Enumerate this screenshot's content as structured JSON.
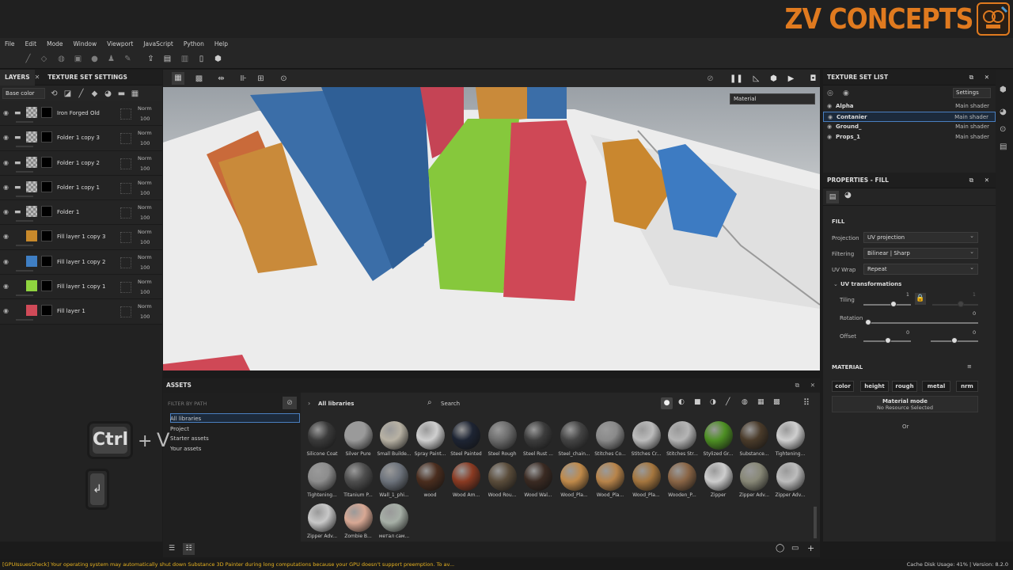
{
  "brand": {
    "text": "ZV CONCEPTS"
  },
  "menu": [
    "File",
    "Edit",
    "Mode",
    "Window",
    "Viewport",
    "JavaScript",
    "Python",
    "Help"
  ],
  "left_panel": {
    "tabs": [
      "LAYERS",
      "TEXTURE SET SETTINGS"
    ],
    "channel": "Base color",
    "layers": [
      {
        "name": "Iron Forged Old",
        "blend": "Norm",
        "opacity": "100",
        "type": "folder"
      },
      {
        "name": "Folder 1 copy 3",
        "blend": "Norm",
        "opacity": "100",
        "type": "folder"
      },
      {
        "name": "Folder 1 copy 2",
        "blend": "Norm",
        "opacity": "100",
        "type": "folder"
      },
      {
        "name": "Folder 1 copy 1",
        "blend": "Norm",
        "opacity": "100",
        "type": "folder"
      },
      {
        "name": "Folder 1",
        "blend": "Norm",
        "opacity": "100",
        "type": "folder"
      },
      {
        "name": "Fill layer 1 copy 3",
        "blend": "Norm",
        "opacity": "100",
        "type": "fill",
        "color": "#c8892b"
      },
      {
        "name": "Fill layer 1 copy 2",
        "blend": "Norm",
        "opacity": "100",
        "type": "fill",
        "color": "#3f7fc4"
      },
      {
        "name": "Fill layer 1 copy 1",
        "blend": "Norm",
        "opacity": "100",
        "type": "fill",
        "color": "#8fd43f"
      },
      {
        "name": "Fill layer 1",
        "blend": "Norm",
        "opacity": "100",
        "type": "fill",
        "color": "#d04a58"
      }
    ]
  },
  "viewport": {
    "material_mode": "Material"
  },
  "texture_set_list": {
    "title": "TEXTURE SET LIST",
    "settings": "Settings",
    "sets": [
      {
        "name": "Alpha",
        "shader": "Main shader"
      },
      {
        "name": "Contanier",
        "shader": "Main shader"
      },
      {
        "name": "Ground_",
        "shader": "Main shader"
      },
      {
        "name": "Props_1",
        "shader": "Main shader"
      }
    ]
  },
  "properties": {
    "title": "PROPERTIES - FILL",
    "fill_heading": "FILL",
    "projection_label": "Projection",
    "projection": "UV projection",
    "filtering_label": "Filtering",
    "filtering": "Bilinear | Sharp",
    "uvwrap_label": "UV Wrap",
    "uvwrap": "Repeat",
    "uv_transform": "UV transformations",
    "tiling_label": "Tiling",
    "tiling_value": "1",
    "tiling_value2": "1",
    "rotation_label": "Rotation",
    "rotation_value": "0",
    "offset_label": "Offset",
    "offset_x": "0",
    "offset_y": "0",
    "material_heading": "MATERIAL",
    "channels": [
      "color",
      "height",
      "rough",
      "metal",
      "nrm"
    ],
    "material_mode_label": "Material mode",
    "material_mode_value": "No Resource Selected",
    "or": "Or"
  },
  "assets": {
    "title": "ASSETS",
    "filter_placeholder": "FILTER BY PATH",
    "libraries": [
      "All libraries",
      "Project",
      "Starter assets",
      "Your assets"
    ],
    "breadcrumb": "All libraries",
    "search": "Search",
    "materials": [
      {
        "name": "Silicone Coat",
        "color": "#3a3a3a"
      },
      {
        "name": "Silver Pure",
        "color": "#9a9a9a"
      },
      {
        "name": "Small Builde...",
        "color": "#b8b2a4"
      },
      {
        "name": "Spray Paint...",
        "color": "#cfcfcf"
      },
      {
        "name": "Steel Painted",
        "color": "#1d2433"
      },
      {
        "name": "Steel Rough",
        "color": "#6c6c6c"
      },
      {
        "name": "Steel Rust ...",
        "color": "#3c3c3c"
      },
      {
        "name": "Steel_chain...",
        "color": "#444444"
      },
      {
        "name": "Stitches Co...",
        "color": "#8a8a8a"
      },
      {
        "name": "Stitches Cr...",
        "color": "#bcbcbc"
      },
      {
        "name": "Stitches Str...",
        "color": "#b5b5b5"
      },
      {
        "name": "Stylized Gr...",
        "color": "#4d8f23"
      },
      {
        "name": "Substance...",
        "color": "#4a3b2a"
      },
      {
        "name": "Tightening...",
        "color": "#cfcfcf"
      },
      {
        "name": "Tightening...",
        "color": "#8d8d8d"
      },
      {
        "name": "Titanium P...",
        "color": "#4e4e4e"
      },
      {
        "name": "Wall_1_phi...",
        "color": "#6d737c"
      },
      {
        "name": "wood",
        "color": "#4a2d1e"
      },
      {
        "name": "Wood Am...",
        "color": "#8a3a22"
      },
      {
        "name": "Wood Rou...",
        "color": "#5a4c3a"
      },
      {
        "name": "Wood Wal...",
        "color": "#3a2a22"
      },
      {
        "name": "Wood_Pla...",
        "color": "#c08a4a"
      },
      {
        "name": "Wood_Pla...",
        "color": "#b8844a"
      },
      {
        "name": "Wood_Pla...",
        "color": "#a5763e"
      },
      {
        "name": "Wooden_P...",
        "color": "#8a6545"
      },
      {
        "name": "Zipper",
        "color": "#cdcdcd"
      },
      {
        "name": "Zipper Adv...",
        "color": "#888877"
      },
      {
        "name": "Zipper Adv...",
        "color": "#bdbdbd"
      },
      {
        "name": "Zipper Adv...",
        "color": "#c8c8c8"
      },
      {
        "name": "Zombie B...",
        "color": "#d8a894"
      },
      {
        "name": "метал сам...",
        "color": "#a6afa6"
      }
    ]
  },
  "overlay_keys": {
    "ctrl": "Ctrl",
    "plus": "+",
    "v": "V",
    "enter": "↲"
  },
  "status": {
    "message": "[GPUIssuesCheck] Your operating system may automatically shut down Substance 3D Painter during long computations because your GPU doesn't support preemption. To av...",
    "right": "Cache Disk Usage:   41% | Version: 8.2.0"
  }
}
